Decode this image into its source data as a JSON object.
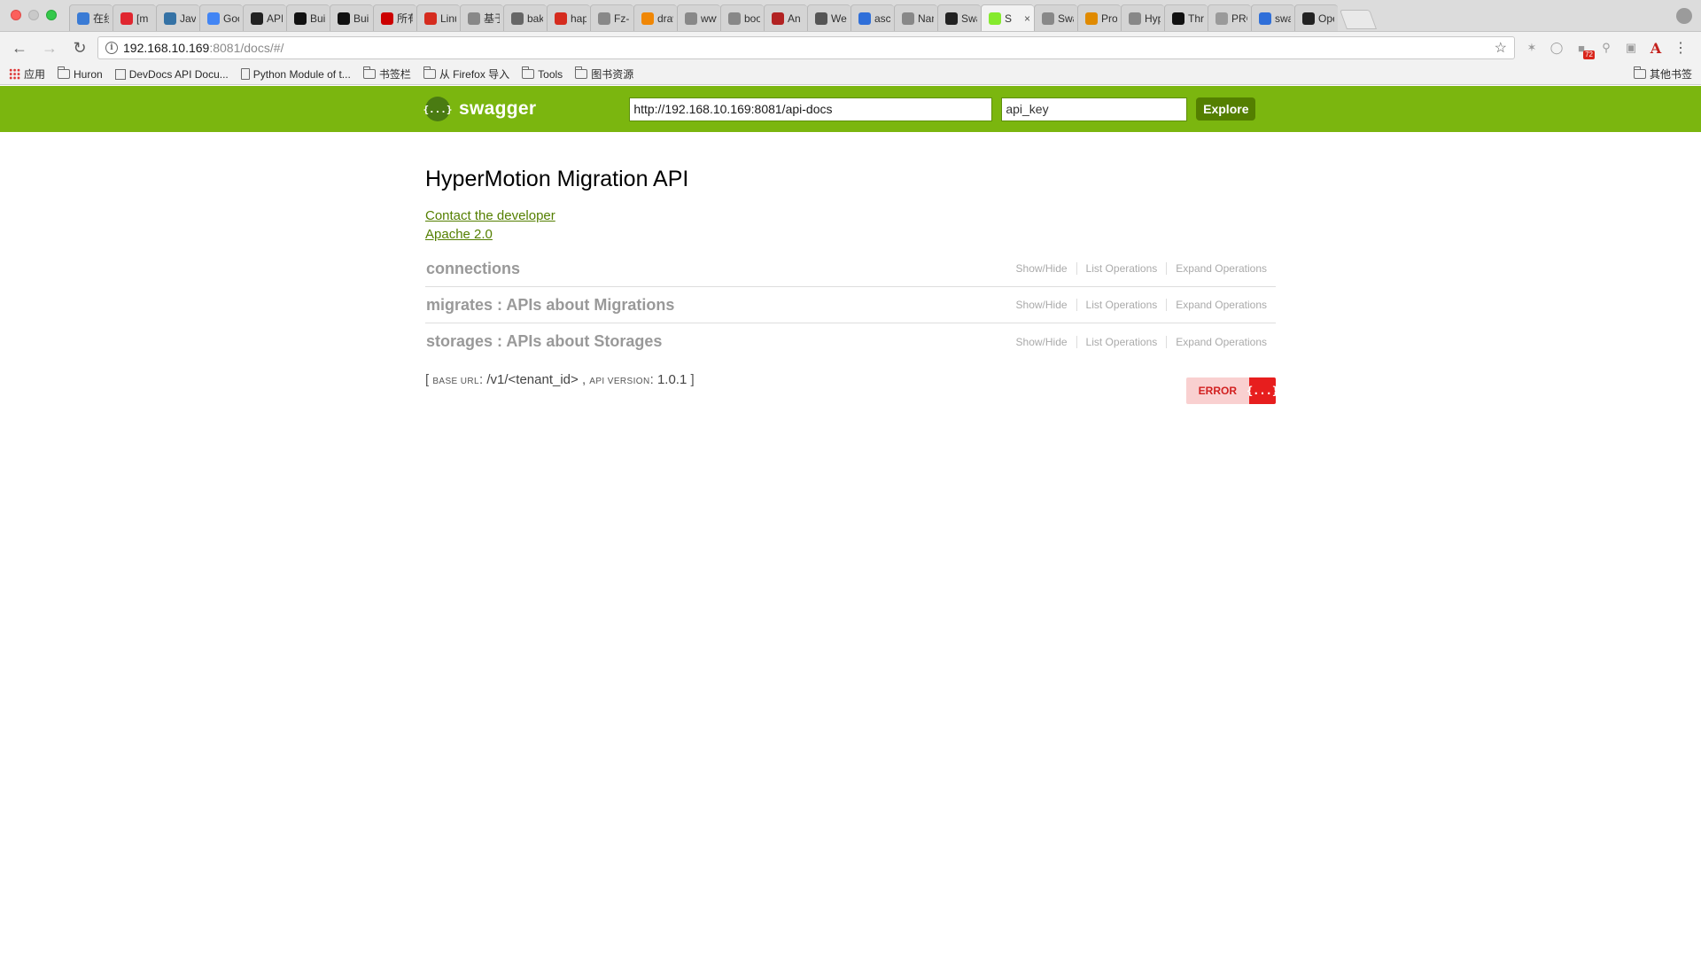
{
  "browser": {
    "tabs": [
      {
        "title": "在线",
        "icon": "code-icon",
        "color": "#3a7bd5"
      },
      {
        "title": "[m",
        "icon": "y-icon",
        "color": "#e0262f"
      },
      {
        "title": "Java",
        "icon": "python-icon",
        "color": "#3572a5"
      },
      {
        "title": "Goo",
        "icon": "translate-icon",
        "color": "#4285f4"
      },
      {
        "title": "API",
        "icon": "percent-icon",
        "color": "#222222"
      },
      {
        "title": "Buil",
        "icon": "m-icon",
        "color": "#111111"
      },
      {
        "title": "Buil",
        "icon": "m-icon",
        "color": "#111111"
      },
      {
        "title": "所有",
        "icon": "redhat-icon",
        "color": "#cc0000"
      },
      {
        "title": "Linu",
        "icon": "c-icon",
        "color": "#d52b1e"
      },
      {
        "title": "基于",
        "icon": "page-icon",
        "color": "#888888"
      },
      {
        "title": "bak",
        "icon": "github-fork-icon",
        "color": "#666666"
      },
      {
        "title": "hap",
        "icon": "c-icon",
        "color": "#d52b1e"
      },
      {
        "title": "Fz-r",
        "icon": "page-icon",
        "color": "#888888"
      },
      {
        "title": "draw",
        "icon": "drawio-icon",
        "color": "#f08705"
      },
      {
        "title": "www",
        "icon": "google-icon",
        "color": "#888888"
      },
      {
        "title": "boo",
        "icon": "google-icon",
        "color": "#888888"
      },
      {
        "title": "An F",
        "icon": "wave-icon",
        "color": "#b22222"
      },
      {
        "title": "Wel",
        "icon": "table-icon",
        "color": "#555555"
      },
      {
        "title": "asci",
        "icon": "paw-icon",
        "color": "#2f6fd9"
      },
      {
        "title": "Nan",
        "icon": "page-icon",
        "color": "#888888"
      },
      {
        "title": "Swa",
        "icon": "github-icon",
        "color": "#222222"
      },
      {
        "title": "S",
        "icon": "swagger-icon",
        "color": "#85ea2d",
        "active": true
      },
      {
        "title": "Swa",
        "icon": "page-icon",
        "color": "#888888"
      },
      {
        "title": "Prot",
        "icon": "proto-icon",
        "color": "#e08a00"
      },
      {
        "title": "Hyp",
        "icon": "page-icon",
        "color": "#888888"
      },
      {
        "title": "Thre",
        "icon": "m-icon",
        "color": "#111111"
      },
      {
        "title": "PRC",
        "icon": "cloud-icon",
        "color": "#9a9a9a"
      },
      {
        "title": "swa",
        "icon": "paw-icon",
        "color": "#2f6fd9"
      },
      {
        "title": "Ope",
        "icon": "github-icon",
        "color": "#222222"
      }
    ],
    "address": {
      "host": "192.168.10.169",
      "path": ":8081/docs/#/"
    },
    "extensions": {
      "badge_count": "72",
      "a_label": "A"
    },
    "bookmarks": [
      {
        "label": "应用",
        "icon": "apps-grid-icon"
      },
      {
        "label": "Huron",
        "icon": "folder-icon"
      },
      {
        "label": "DevDocs API Docu...",
        "icon": "devdocs-icon"
      },
      {
        "label": "Python Module of t...",
        "icon": "page-icon"
      },
      {
        "label": "书签栏",
        "icon": "folder-icon"
      },
      {
        "label": "从 Firefox 导入",
        "icon": "folder-icon"
      },
      {
        "label": "Tools",
        "icon": "folder-icon"
      },
      {
        "label": "图书资源",
        "icon": "folder-icon"
      }
    ],
    "other_bookmarks": "其他书签"
  },
  "swagger": {
    "brand": "swagger",
    "logo_glyph": "{...}",
    "url_value": "http://192.168.10.169:8081/api-docs",
    "api_key_value": "api_key",
    "explore_label": "Explore",
    "header_color": "#7bb60f",
    "button_color": "#547f00"
  },
  "api": {
    "title": "HyperMotion Migration API",
    "contact_link": "Contact the developer",
    "license_link": "Apache 2.0",
    "resources": [
      {
        "name": "connections",
        "ops": [
          "Show/Hide",
          "List Operations",
          "Expand Operations"
        ]
      },
      {
        "name": "migrates : APIs about Migrations",
        "ops": [
          "Show/Hide",
          "List Operations",
          "Expand Operations"
        ]
      },
      {
        "name": "storages : APIs about Storages",
        "ops": [
          "Show/Hide",
          "List Operations",
          "Expand Operations"
        ]
      }
    ],
    "footer": {
      "open_bracket": "[",
      "base_url_label": "base url",
      "base_url_value": "/v1/<tenant_id>",
      "separator": ",",
      "api_version_label": "api version",
      "api_version_value": "1.0.1",
      "close_bracket": "]"
    },
    "validator": {
      "text": "ERROR",
      "badge": "{...}",
      "text_color": "#d22020",
      "badge_color": "#e71e1e"
    }
  }
}
